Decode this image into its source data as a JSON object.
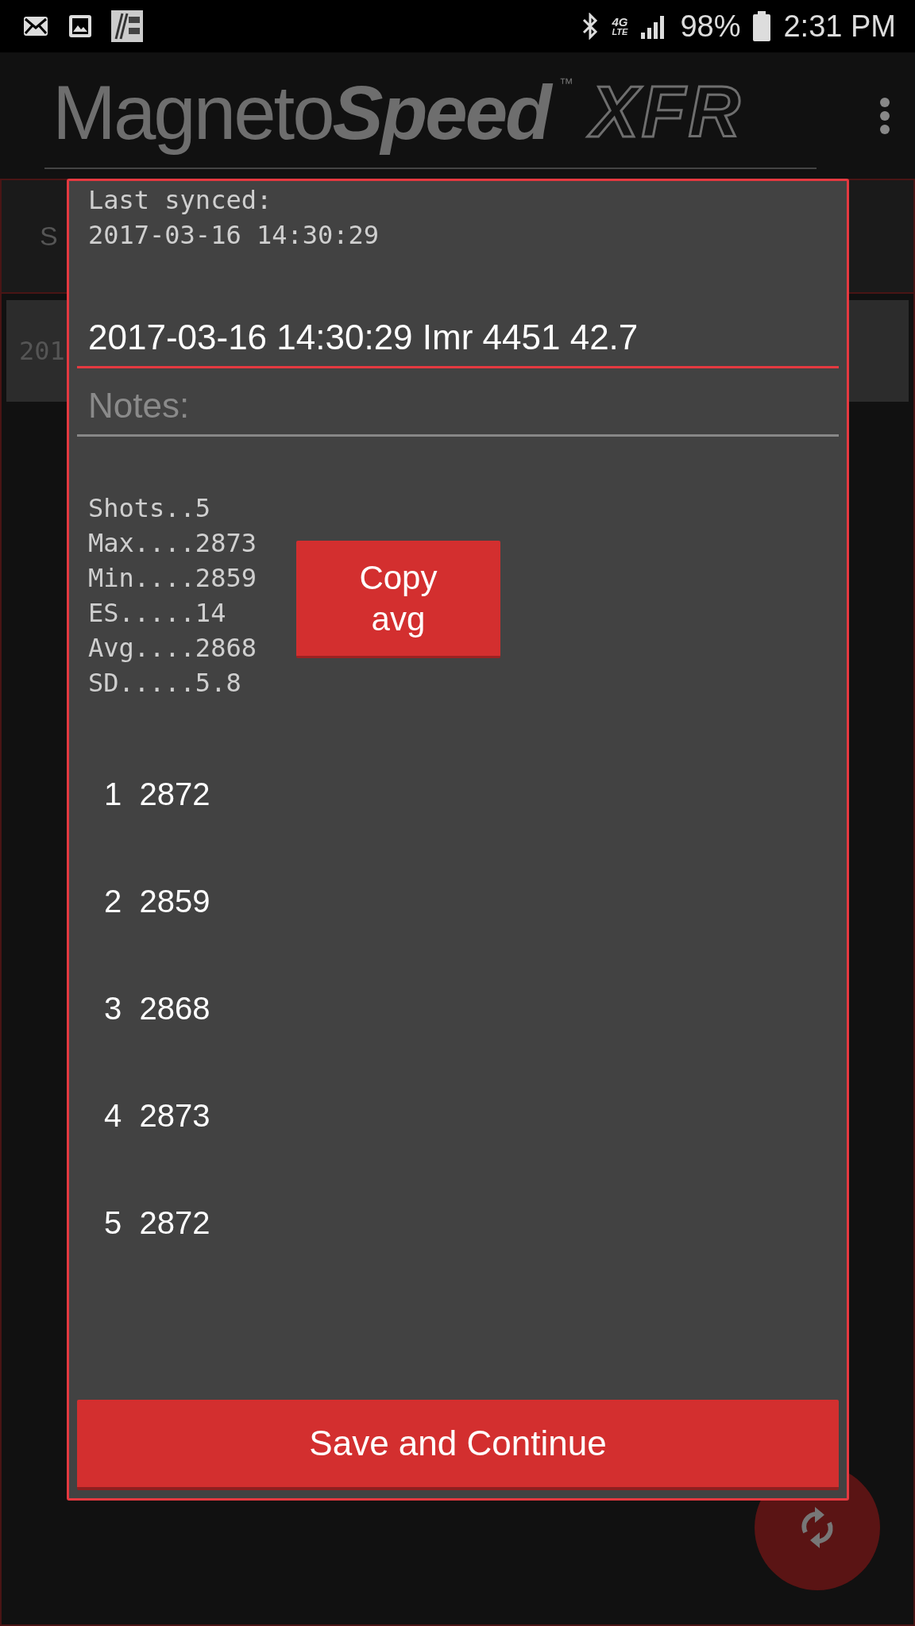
{
  "status_bar": {
    "network": "4G",
    "network_sub": "LTE",
    "battery": "98%",
    "time": "2:31 PM"
  },
  "app_bar": {
    "logo": "Magneto**Speed**",
    "logo_mark": "™",
    "logo_suffix": "XFR"
  },
  "background": {
    "tab_label": "S",
    "row_text": "201"
  },
  "dialog": {
    "last_synced_label": "Last synced:",
    "last_synced": "2017-03-16 14:30:29",
    "title_field": {
      "value": "2017-03-16 14:30:29 Imr 4451 42.7",
      "focused": true
    },
    "notes_field": {
      "placeholder": "Notes:",
      "focused": false
    },
    "stats": [
      "Shots..5",
      "Max....2873",
      "Min....2859",
      "ES.....14",
      "Avg....2868",
      "SD.....5.8"
    ],
    "copy_button": "Copy avg",
    "shots": [
      {
        "number": "1",
        "velocity": "2872"
      },
      {
        "number": "2",
        "velocity": "2859"
      },
      {
        "number": "3",
        "velocity": "2868"
      },
      {
        "number": "4",
        "velocity": "2873"
      },
      {
        "number": "5",
        "velocity": "2872"
      }
    ],
    "save_button": "Save and Continue"
  }
}
